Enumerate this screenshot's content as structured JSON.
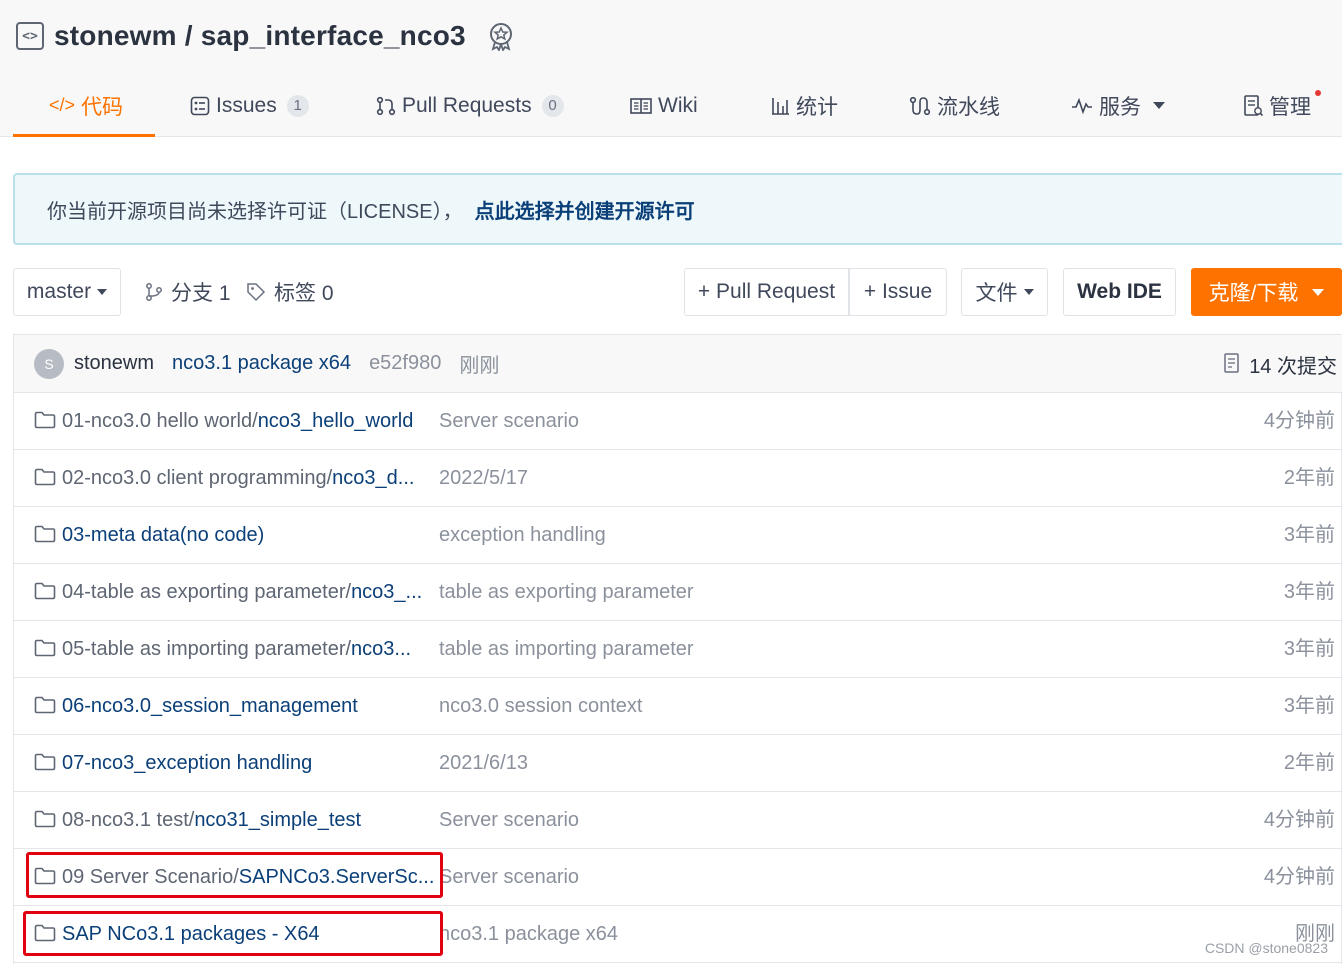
{
  "repo": {
    "owner": "stonewm",
    "separator": "/",
    "name": "sap_interface_nco3"
  },
  "tabs": [
    {
      "label": "代码",
      "icon": "code-icon"
    },
    {
      "label": "Issues",
      "icon": "issues-icon",
      "count": "1"
    },
    {
      "label": "Pull Requests",
      "icon": "pull-request-icon",
      "count": "0"
    },
    {
      "label": "Wiki",
      "icon": "wiki-icon"
    },
    {
      "label": "统计",
      "icon": "stats-icon"
    },
    {
      "label": "流水线",
      "icon": "pipeline-icon"
    },
    {
      "label": "服务",
      "icon": "service-icon"
    },
    {
      "label": "管理",
      "icon": "manage-icon"
    }
  ],
  "banner": {
    "message": "你当前开源项目尚未选择许可证（LICENSE），",
    "link": "点此选择并创建开源许可"
  },
  "toolbar": {
    "branch": "master",
    "branches": "分支 1",
    "tags": "标签 0",
    "pull_request": "+ Pull Request",
    "issue": "+ Issue",
    "file": "文件",
    "web_ide": "Web IDE",
    "clone": "克隆/下载"
  },
  "commit": {
    "avatar": "S",
    "author": "stonewm",
    "message": "nco3.1 package x64",
    "sha": "e52f980",
    "time": "刚刚",
    "count": "14 次提交"
  },
  "files": [
    {
      "dir": "01-nco3.0 hello world/",
      "leaf": "nco3_hello_world",
      "message": "Server scenario",
      "time": "4分钟前"
    },
    {
      "dir": "02-nco3.0 client programming/",
      "leaf": "nco3_d...",
      "message": "2022/5/17",
      "time": "2年前"
    },
    {
      "dir": "",
      "leaf": "03-meta data(no code)",
      "message": "exception handling",
      "time": "3年前"
    },
    {
      "dir": "04-table as exporting parameter/",
      "leaf": "nco3_...",
      "message": "table as exporting parameter",
      "time": "3年前"
    },
    {
      "dir": "05-table as importing parameter/",
      "leaf": "nco3...",
      "message": "table as importing parameter",
      "time": "3年前"
    },
    {
      "dir": "",
      "leaf": "06-nco3.0_session_management",
      "message": "nco3.0 session context",
      "time": "3年前"
    },
    {
      "dir": "",
      "leaf": "07-nco3_exception handling",
      "message": "2021/6/13",
      "time": "2年前"
    },
    {
      "dir": "08-nco3.1 test/",
      "leaf": "nco31_simple_test",
      "message": "Server scenario",
      "time": "4分钟前"
    },
    {
      "dir": "09 Server Scenario/",
      "leaf": "SAPNCo3.ServerSc...",
      "message": "Server scenario",
      "time": "4分钟前"
    },
    {
      "dir": "",
      "leaf": "SAP NCo3.1 packages - X64",
      "message": "nco3.1 package x64",
      "time": "刚刚"
    }
  ],
  "watermark": "CSDN @stone0823",
  "colors": {
    "accent": "#fe7300",
    "link": "#0b3f78",
    "highlight": "#e0000f"
  }
}
